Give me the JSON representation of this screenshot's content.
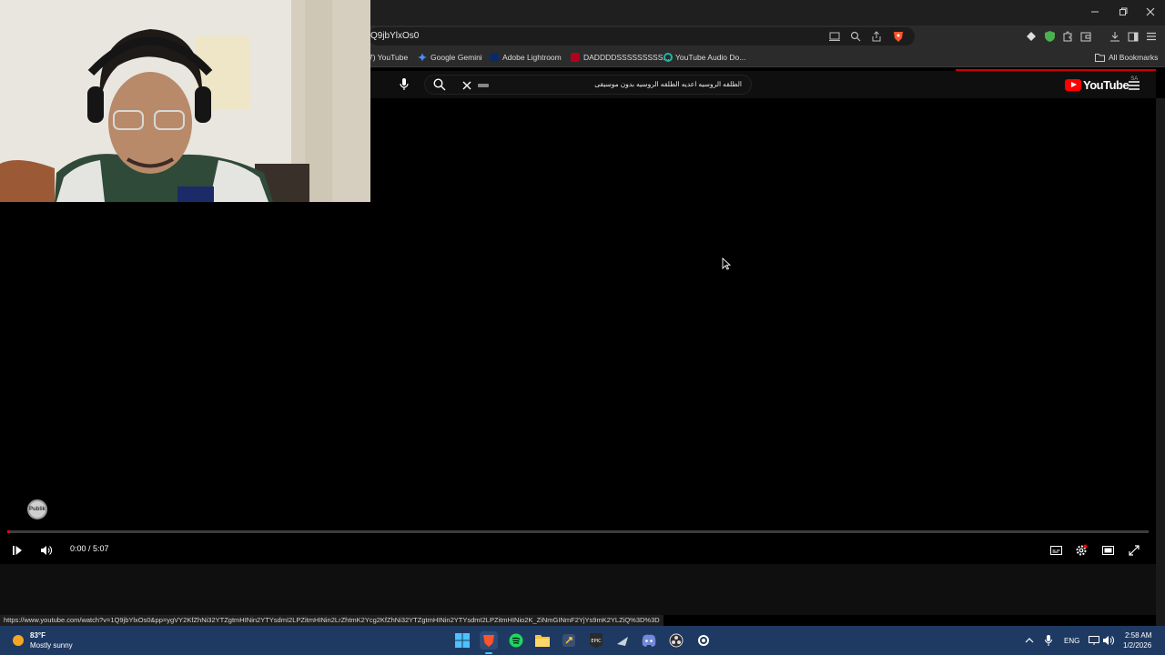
{
  "browser": {
    "url_fragment": "Q9jbYlxOs0",
    "bookmarks": [
      {
        "label": "7) YouTube",
        "color": "#cc0000"
      },
      {
        "label": "Google Gemini",
        "color": "#4b8df8"
      },
      {
        "label": "Adobe Lightroom",
        "color": "#0b2a63"
      },
      {
        "label": "DADDDDSSSSSSSSS...",
        "color": "#b3001b"
      },
      {
        "label": "YouTube Audio Do...",
        "color": "#1fb6a3"
      }
    ],
    "all_bookmarks_label": "All Bookmarks"
  },
  "youtube": {
    "search_query": "الطلقه الروسيه اعديه الطلقه الروسيه بدون موسيقى",
    "logo_text": "YouTube",
    "region_code": "SA",
    "watermark_text": "Publik",
    "player": {
      "current_time": "0:00",
      "separator": " / ",
      "duration": "5:07",
      "progress": 0.0
    }
  },
  "status_bar": {
    "hover_url": "https://www.youtube.com/watch?v=1Q9jbYlxOs0&pp=ygVY2KfZhNi32YTZgtmHINin2YTYsdmI2LPZitmHINin2LrZhtmK2Ycg2KfZhNi32YTZgtmHINin2YTYsdmI2LPZitmHINio2K_ZiNmGINmF2YjYs9mK2YLZiQ%3D%3D"
  },
  "taskbar": {
    "weather_temp": "83°F",
    "weather_desc": "Mostly sunny",
    "language": "ENG",
    "time": "2:58 AM",
    "date": "1/2/2026"
  },
  "colors": {
    "accent_red": "#ff0000",
    "taskbar_bg": "#1e3a62"
  }
}
